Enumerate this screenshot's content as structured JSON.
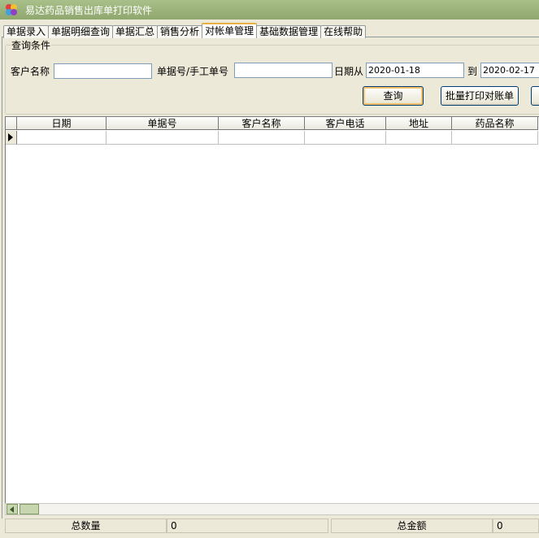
{
  "window": {
    "title": "易达药品销售出库单打印软件"
  },
  "tabs": [
    "单据录入",
    "单据明细查询",
    "单据汇总",
    "销售分析",
    "对帐单管理",
    "基础数据管理",
    "在线帮助"
  ],
  "active_tab": 4,
  "query": {
    "group_title": "查询条件",
    "customer_label": "客户名称",
    "customer_value": "",
    "docno_label": "单据号/手工单号",
    "docno_value": "",
    "date_from_label": "日期从",
    "date_from": "2020-01-18",
    "date_to_label": "到",
    "date_to": "2020-02-17",
    "search_button": "查询",
    "batch_print_button": "批量打印对账单"
  },
  "grid": {
    "columns": [
      "日期",
      "单据号",
      "客户名称",
      "客户电话",
      "地址",
      "药品名称"
    ]
  },
  "status": {
    "total_qty_label": "总数量",
    "total_qty": "0",
    "total_amount_label": "总金额",
    "total_amount": "0"
  },
  "colors": {
    "titlebar": "#8fa86e",
    "window_bg": "#ece9d8",
    "active_tab_highlight": "#e6b043"
  }
}
